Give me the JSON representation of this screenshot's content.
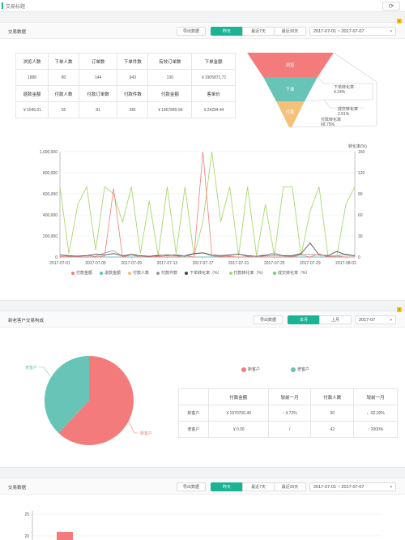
{
  "topbar": {
    "title": "交易标题"
  },
  "panel1": {
    "title": "交易数据",
    "export_label": "导出数据",
    "tabs": [
      "昨天",
      "最近7天",
      "最近30天"
    ],
    "date_range": "2017-07-01 ~ 2017-07-07",
    "badge": "1",
    "table": {
      "rows": [
        [
          "浏览人数",
          "下单人数",
          "订单数",
          "下单件数",
          "有效订单数",
          "下单金额"
        ],
        [
          "1888",
          "80",
          "144",
          "643",
          "130",
          "￥1905871.71"
        ],
        [
          "退款金额",
          "付款人数",
          "付款订单数",
          "付款件数",
          "付款金额",
          "客单价"
        ],
        [
          "￥1046.01",
          "55",
          "81",
          "381",
          "￥1967849.99",
          "￥24294.44"
        ]
      ]
    },
    "funnel": {
      "stages": [
        "浏览",
        "下单",
        "付款"
      ],
      "colors": [
        "#f47b7b",
        "#68c4b7",
        "#f5c07a"
      ],
      "labels": [
        {
          "name": "下单转化率",
          "value": "4.24%"
        },
        {
          "name": "成交转化率",
          "value": "2.91%"
        },
        {
          "name": "付款转化率",
          "value": "68.75%"
        }
      ]
    },
    "legend": [
      {
        "name": "付款金额",
        "color": "#f47b7b"
      },
      {
        "name": "退款金额",
        "color": "#5cc0b5"
      },
      {
        "name": "付款人数",
        "color": "#f5c07a"
      },
      {
        "name": "付款件数",
        "color": "#999999"
      },
      {
        "name": "下单转化率（%）",
        "color": "#444444"
      },
      {
        "name": "付款转化率（%）",
        "color": "#a9d86e"
      },
      {
        "name": "成交转化率（%）",
        "color": "#6fcf6f"
      }
    ]
  },
  "chart_data": {
    "type": "line",
    "ylabel_right": "转化率(%)",
    "ylim_left": [
      0,
      1000000
    ],
    "ylim_right": [
      0,
      150
    ],
    "left_ticks": [
      "0",
      "200,000",
      "400,000",
      "600,000",
      "800,000",
      "1,000,000"
    ],
    "right_ticks": [
      "0",
      "30",
      "60",
      "90",
      "120",
      "150"
    ],
    "x": [
      "2017-07-01",
      "2017-07-02",
      "2017-07-03",
      "2017-07-04",
      "2017-07-05",
      "2017-07-06",
      "2017-07-07",
      "2017-07-08",
      "2017-07-09",
      "2017-07-10",
      "2017-07-11",
      "2017-07-12",
      "2017-07-13",
      "2017-07-14",
      "2017-07-15",
      "2017-07-16",
      "2017-07-17",
      "2017-07-18",
      "2017-07-19",
      "2017-07-20",
      "2017-07-21",
      "2017-07-22",
      "2017-07-23",
      "2017-07-24",
      "2017-07-25",
      "2017-07-26",
      "2017-07-27",
      "2017-07-28",
      "2017-07-29",
      "2017-07-30",
      "2017-07-31",
      "2017-08-01",
      "2017-08-02",
      "2017-08-03"
    ],
    "x_tick_labels": [
      "2017-07-01",
      "2017-07-05",
      "2017-07-09",
      "2017-07-13",
      "2017-07-17",
      "2017-07-21",
      "2017-07-25",
      "2017-07-29",
      "2017-08-02"
    ],
    "series": [
      {
        "name": "付款金额",
        "axis": "left",
        "color": "#f47b7b",
        "values": [
          5000,
          0,
          3000,
          0,
          0,
          10000,
          650000,
          0,
          20000,
          0,
          0,
          5000,
          0,
          0,
          15000,
          0,
          1000000,
          20000,
          0,
          5000,
          0,
          0,
          10000,
          0,
          0,
          0,
          0,
          20000,
          0,
          30000,
          0,
          10000,
          0,
          0
        ]
      },
      {
        "name": "退款金额",
        "axis": "left",
        "color": "#5cc0b5",
        "values": [
          0,
          0,
          0,
          0,
          0,
          0,
          0,
          0,
          0,
          0,
          0,
          0,
          0,
          0,
          0,
          0,
          0,
          0,
          0,
          0,
          0,
          0,
          0,
          0,
          0,
          0,
          0,
          0,
          0,
          0,
          0,
          0,
          0,
          0
        ]
      },
      {
        "name": "付款件数",
        "axis": "left",
        "color": "#999999",
        "values": [
          20000,
          5000,
          10000,
          15000,
          5000,
          40000,
          60000,
          5000,
          30000,
          10000,
          5000,
          20000,
          10000,
          25000,
          5000,
          30000,
          40000,
          10000,
          5000,
          15000,
          30000,
          5000,
          10000,
          20000,
          40000,
          10000,
          5000,
          30000,
          25000,
          20000,
          5000,
          10000,
          30000,
          10000
        ]
      },
      {
        "name": "下单转化率（%）",
        "axis": "right",
        "color": "#444444",
        "values": [
          3,
          2,
          1,
          2,
          4,
          3,
          5,
          2,
          3,
          2,
          1,
          2,
          3,
          2,
          2,
          5,
          6,
          3,
          2,
          3,
          4,
          2,
          1,
          2,
          3,
          2,
          2,
          5,
          20,
          3,
          2,
          8,
          3,
          2
        ]
      },
      {
        "name": "付款转化率（%）",
        "axis": "right",
        "color": "#a9d86e",
        "values": [
          100,
          5,
          75,
          100,
          10,
          100,
          90,
          50,
          100,
          5,
          80,
          2,
          100,
          5,
          100,
          2,
          50,
          150,
          50,
          100,
          2,
          100,
          2,
          75,
          2,
          100,
          100,
          2,
          65,
          100,
          2,
          2,
          75,
          100
        ]
      }
    ]
  },
  "panel2": {
    "title": "新老客户交易构成",
    "export_label": "导出数据",
    "tabs": [
      "本月",
      "上月"
    ],
    "month": "2017-07",
    "badge": "2",
    "legend": [
      {
        "name": "新客户",
        "color": "#f47b7b"
      },
      {
        "name": "老客户",
        "color": "#68c4b7"
      }
    ],
    "pie": {
      "slices": [
        {
          "name": "新客户",
          "value": 62,
          "color": "#f47b7b"
        },
        {
          "name": "老客户",
          "value": 38,
          "color": "#68c4b7"
        }
      ]
    },
    "table": {
      "headers": [
        "",
        "付款金额",
        "较前一月",
        "付款人数",
        "较前一月"
      ],
      "rows": [
        [
          "新客户",
          "￥1970700.49",
          "↑ 4.73%",
          "30",
          "↓ -92.00%"
        ],
        [
          "老客户",
          "￥0.00",
          "/",
          "42",
          "↑ 2000%"
        ]
      ]
    }
  },
  "panel3": {
    "title": "交易数据",
    "export_label": "导出数据",
    "tabs": [
      "昨天",
      "最近7天",
      "最近30天"
    ],
    "date_range": "2017-07-01 ~ 2017-07-07",
    "y_ticks": [
      "25",
      "20"
    ]
  }
}
